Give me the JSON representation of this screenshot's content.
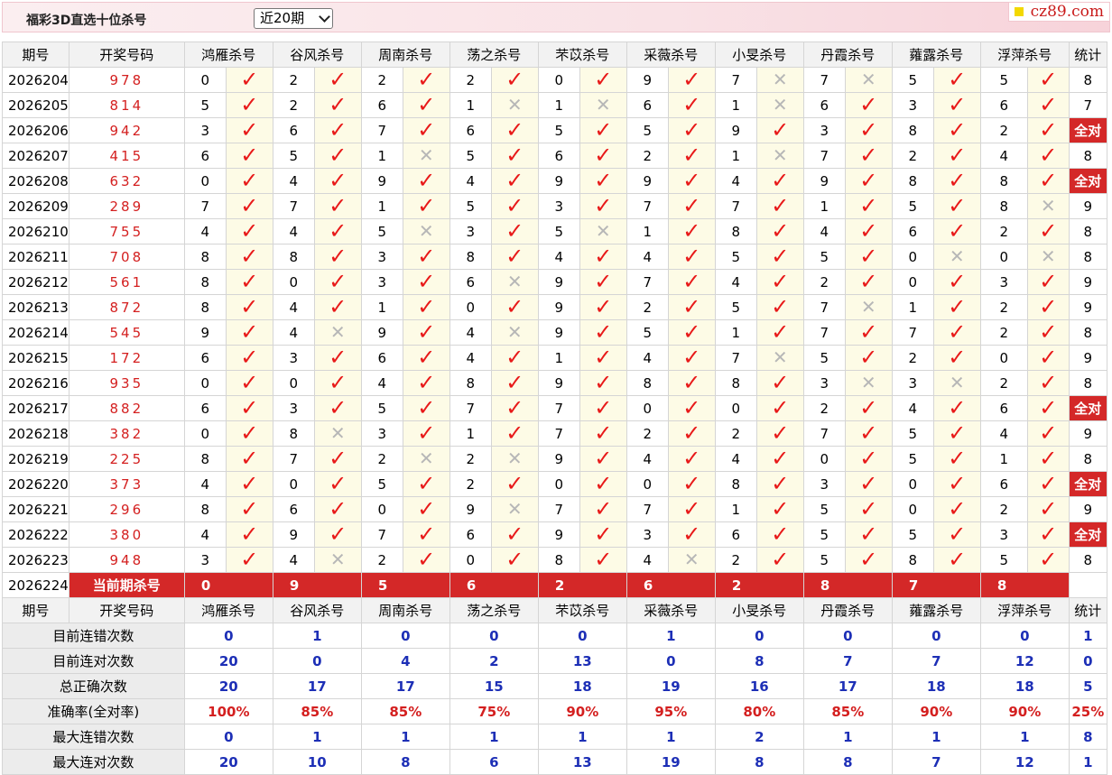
{
  "header": {
    "title": "福彩3D直选十位杀号",
    "period_select": "近20期",
    "logo": "cz89.com"
  },
  "columns": {
    "issue": "期号",
    "draw": "开奖号码",
    "experts": [
      "鸿雁杀号",
      "谷风杀号",
      "周南杀号",
      "荡之杀号",
      "芣苡杀号",
      "采薇杀号",
      "小旻杀号",
      "丹霞杀号",
      "蕹露杀号",
      "浮萍杀号"
    ],
    "tally": "统计"
  },
  "rows": [
    {
      "issue": "2026204",
      "draw": "978",
      "kills": [
        [
          0,
          true
        ],
        [
          2,
          true
        ],
        [
          2,
          true
        ],
        [
          2,
          true
        ],
        [
          0,
          true
        ],
        [
          9,
          true
        ],
        [
          7,
          false
        ],
        [
          7,
          false
        ],
        [
          5,
          true
        ],
        [
          5,
          true
        ]
      ],
      "tally": "8"
    },
    {
      "issue": "2026205",
      "draw": "814",
      "kills": [
        [
          5,
          true
        ],
        [
          2,
          true
        ],
        [
          6,
          true
        ],
        [
          1,
          false
        ],
        [
          1,
          false
        ],
        [
          6,
          true
        ],
        [
          1,
          false
        ],
        [
          6,
          true
        ],
        [
          3,
          true
        ],
        [
          6,
          true
        ]
      ],
      "tally": "7"
    },
    {
      "issue": "2026206",
      "draw": "942",
      "kills": [
        [
          3,
          true
        ],
        [
          6,
          true
        ],
        [
          7,
          true
        ],
        [
          6,
          true
        ],
        [
          5,
          true
        ],
        [
          5,
          true
        ],
        [
          9,
          true
        ],
        [
          3,
          true
        ],
        [
          8,
          true
        ],
        [
          2,
          true
        ]
      ],
      "tally": "全对"
    },
    {
      "issue": "2026207",
      "draw": "415",
      "kills": [
        [
          6,
          true
        ],
        [
          5,
          true
        ],
        [
          1,
          false
        ],
        [
          5,
          true
        ],
        [
          6,
          true
        ],
        [
          2,
          true
        ],
        [
          1,
          false
        ],
        [
          7,
          true
        ],
        [
          2,
          true
        ],
        [
          4,
          true
        ]
      ],
      "tally": "8"
    },
    {
      "issue": "2026208",
      "draw": "632",
      "kills": [
        [
          0,
          true
        ],
        [
          4,
          true
        ],
        [
          9,
          true
        ],
        [
          4,
          true
        ],
        [
          9,
          true
        ],
        [
          9,
          true
        ],
        [
          4,
          true
        ],
        [
          9,
          true
        ],
        [
          8,
          true
        ],
        [
          8,
          true
        ]
      ],
      "tally": "全对"
    },
    {
      "issue": "2026209",
      "draw": "289",
      "kills": [
        [
          7,
          true
        ],
        [
          7,
          true
        ],
        [
          1,
          true
        ],
        [
          5,
          true
        ],
        [
          3,
          true
        ],
        [
          7,
          true
        ],
        [
          7,
          true
        ],
        [
          1,
          true
        ],
        [
          5,
          true
        ],
        [
          8,
          false
        ]
      ],
      "tally": "9"
    },
    {
      "issue": "2026210",
      "draw": "755",
      "kills": [
        [
          4,
          true
        ],
        [
          4,
          true
        ],
        [
          5,
          false
        ],
        [
          3,
          true
        ],
        [
          5,
          false
        ],
        [
          1,
          true
        ],
        [
          8,
          true
        ],
        [
          4,
          true
        ],
        [
          6,
          true
        ],
        [
          2,
          true
        ]
      ],
      "tally": "8"
    },
    {
      "issue": "2026211",
      "draw": "708",
      "kills": [
        [
          8,
          true
        ],
        [
          8,
          true
        ],
        [
          3,
          true
        ],
        [
          8,
          true
        ],
        [
          4,
          true
        ],
        [
          4,
          true
        ],
        [
          5,
          true
        ],
        [
          5,
          true
        ],
        [
          0,
          false
        ],
        [
          0,
          false
        ]
      ],
      "tally": "8"
    },
    {
      "issue": "2026212",
      "draw": "561",
      "kills": [
        [
          8,
          true
        ],
        [
          0,
          true
        ],
        [
          3,
          true
        ],
        [
          6,
          false
        ],
        [
          9,
          true
        ],
        [
          7,
          true
        ],
        [
          4,
          true
        ],
        [
          2,
          true
        ],
        [
          0,
          true
        ],
        [
          3,
          true
        ]
      ],
      "tally": "9"
    },
    {
      "issue": "2026213",
      "draw": "872",
      "kills": [
        [
          8,
          true
        ],
        [
          4,
          true
        ],
        [
          1,
          true
        ],
        [
          0,
          true
        ],
        [
          9,
          true
        ],
        [
          2,
          true
        ],
        [
          5,
          true
        ],
        [
          7,
          false
        ],
        [
          1,
          true
        ],
        [
          2,
          true
        ]
      ],
      "tally": "9"
    },
    {
      "issue": "2026214",
      "draw": "545",
      "kills": [
        [
          9,
          true
        ],
        [
          4,
          false
        ],
        [
          9,
          true
        ],
        [
          4,
          false
        ],
        [
          9,
          true
        ],
        [
          5,
          true
        ],
        [
          1,
          true
        ],
        [
          7,
          true
        ],
        [
          7,
          true
        ],
        [
          2,
          true
        ]
      ],
      "tally": "8"
    },
    {
      "issue": "2026215",
      "draw": "172",
      "kills": [
        [
          6,
          true
        ],
        [
          3,
          true
        ],
        [
          6,
          true
        ],
        [
          4,
          true
        ],
        [
          1,
          true
        ],
        [
          4,
          true
        ],
        [
          7,
          false
        ],
        [
          5,
          true
        ],
        [
          2,
          true
        ],
        [
          0,
          true
        ]
      ],
      "tally": "9"
    },
    {
      "issue": "2026216",
      "draw": "935",
      "kills": [
        [
          0,
          true
        ],
        [
          0,
          true
        ],
        [
          4,
          true
        ],
        [
          8,
          true
        ],
        [
          9,
          true
        ],
        [
          8,
          true
        ],
        [
          8,
          true
        ],
        [
          3,
          false
        ],
        [
          3,
          false
        ],
        [
          2,
          true
        ]
      ],
      "tally": "8"
    },
    {
      "issue": "2026217",
      "draw": "882",
      "kills": [
        [
          6,
          true
        ],
        [
          3,
          true
        ],
        [
          5,
          true
        ],
        [
          7,
          true
        ],
        [
          7,
          true
        ],
        [
          0,
          true
        ],
        [
          0,
          true
        ],
        [
          2,
          true
        ],
        [
          4,
          true
        ],
        [
          6,
          true
        ]
      ],
      "tally": "全对"
    },
    {
      "issue": "2026218",
      "draw": "382",
      "kills": [
        [
          0,
          true
        ],
        [
          8,
          false
        ],
        [
          3,
          true
        ],
        [
          1,
          true
        ],
        [
          7,
          true
        ],
        [
          2,
          true
        ],
        [
          2,
          true
        ],
        [
          7,
          true
        ],
        [
          5,
          true
        ],
        [
          4,
          true
        ]
      ],
      "tally": "9"
    },
    {
      "issue": "2026219",
      "draw": "225",
      "kills": [
        [
          8,
          true
        ],
        [
          7,
          true
        ],
        [
          2,
          false
        ],
        [
          2,
          false
        ],
        [
          9,
          true
        ],
        [
          4,
          true
        ],
        [
          4,
          true
        ],
        [
          0,
          true
        ],
        [
          5,
          true
        ],
        [
          1,
          true
        ]
      ],
      "tally": "8"
    },
    {
      "issue": "2026220",
      "draw": "373",
      "kills": [
        [
          4,
          true
        ],
        [
          0,
          true
        ],
        [
          5,
          true
        ],
        [
          2,
          true
        ],
        [
          0,
          true
        ],
        [
          0,
          true
        ],
        [
          8,
          true
        ],
        [
          3,
          true
        ],
        [
          0,
          true
        ],
        [
          6,
          true
        ]
      ],
      "tally": "全对"
    },
    {
      "issue": "2026221",
      "draw": "296",
      "kills": [
        [
          8,
          true
        ],
        [
          6,
          true
        ],
        [
          0,
          true
        ],
        [
          9,
          false
        ],
        [
          7,
          true
        ],
        [
          7,
          true
        ],
        [
          1,
          true
        ],
        [
          5,
          true
        ],
        [
          0,
          true
        ],
        [
          2,
          true
        ]
      ],
      "tally": "9"
    },
    {
      "issue": "2026222",
      "draw": "380",
      "kills": [
        [
          4,
          true
        ],
        [
          9,
          true
        ],
        [
          7,
          true
        ],
        [
          6,
          true
        ],
        [
          9,
          true
        ],
        [
          3,
          true
        ],
        [
          6,
          true
        ],
        [
          5,
          true
        ],
        [
          5,
          true
        ],
        [
          3,
          true
        ]
      ],
      "tally": "全对"
    },
    {
      "issue": "2026223",
      "draw": "948",
      "kills": [
        [
          3,
          true
        ],
        [
          4,
          false
        ],
        [
          2,
          true
        ],
        [
          0,
          true
        ],
        [
          8,
          true
        ],
        [
          4,
          false
        ],
        [
          2,
          true
        ],
        [
          5,
          true
        ],
        [
          8,
          true
        ],
        [
          5,
          true
        ]
      ],
      "tally": "8"
    }
  ],
  "current": {
    "issue": "2026224",
    "label": "当前期杀号",
    "kills": [
      "0",
      "9",
      "5",
      "6",
      "2",
      "6",
      "2",
      "8",
      "7",
      "8"
    ]
  },
  "stats": [
    {
      "label": "目前连错次数",
      "values": [
        "0",
        "1",
        "0",
        "0",
        "0",
        "1",
        "0",
        "0",
        "0",
        "0"
      ],
      "tally": "1",
      "pct": false
    },
    {
      "label": "目前连对次数",
      "values": [
        "20",
        "0",
        "4",
        "2",
        "13",
        "0",
        "8",
        "7",
        "7",
        "12"
      ],
      "tally": "0",
      "pct": false
    },
    {
      "label": "总正确次数",
      "values": [
        "20",
        "17",
        "17",
        "15",
        "18",
        "19",
        "16",
        "17",
        "18",
        "18"
      ],
      "tally": "5",
      "pct": false
    },
    {
      "label": "准确率(全对率)",
      "values": [
        "100%",
        "85%",
        "85%",
        "75%",
        "90%",
        "95%",
        "80%",
        "85%",
        "90%",
        "90%"
      ],
      "tally": "25%",
      "pct": true
    },
    {
      "label": "最大连错次数",
      "values": [
        "0",
        "1",
        "1",
        "1",
        "1",
        "1",
        "2",
        "1",
        "1",
        "1"
      ],
      "tally": "8",
      "pct": false
    },
    {
      "label": "最大连对次数",
      "values": [
        "20",
        "10",
        "8",
        "6",
        "13",
        "19",
        "8",
        "8",
        "7",
        "12"
      ],
      "tally": "1",
      "pct": false
    }
  ],
  "symbols": {
    "hit": "✓",
    "miss": "✕"
  },
  "colors": {
    "accent_red": "#d42828",
    "stat_blue": "#1d2fb6",
    "mark_bg": "#fdfbe6"
  }
}
